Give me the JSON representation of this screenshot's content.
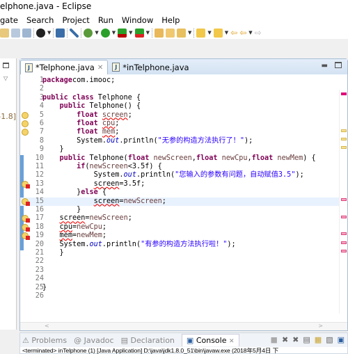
{
  "window": {
    "title": "elphone.java - Eclipse"
  },
  "menu": [
    "gate",
    "Search",
    "Project",
    "Run",
    "Window",
    "Help"
  ],
  "toolbar": {
    "icons": [
      "save-all-icon",
      "print-icon",
      "toggle-mark-icon",
      "person-icon",
      "terminal-icon",
      "skip-breakpoints-icon",
      "debug-icon",
      "run-icon",
      "coverage-icon",
      "external-tools-icon",
      "new-package-icon",
      "open-type-icon",
      "search-icon",
      "next-annotation-icon",
      "prev-annotation-icon",
      "back-icon",
      "forward-icon"
    ]
  },
  "left_panel": {
    "label": "-1.8]"
  },
  "editor": {
    "tabs": [
      {
        "label": "*Telphone.java",
        "active": true
      },
      {
        "label": "*inTelphone.java",
        "active": false
      }
    ],
    "lines": [
      {
        "n": "1",
        "html": [
          [
            "kw",
            "package"
          ],
          [
            "",
            "com.imooc;"
          ]
        ]
      },
      {
        "n": "2",
        "html": []
      },
      {
        "n": "3",
        "html": [
          [
            "kw",
            "public class"
          ],
          [
            "",
            " Telphone {"
          ]
        ]
      },
      {
        "n": "4",
        "html": [
          [
            "",
            "    "
          ],
          [
            "kw",
            "public"
          ],
          [
            "",
            " Telphone() {"
          ]
        ]
      },
      {
        "n": "5",
        "marker": "warning",
        "html": [
          [
            "",
            "        "
          ],
          [
            "kw",
            "float"
          ],
          [
            "",
            " "
          ],
          [
            "var err",
            "screen"
          ],
          [
            "",
            ";"
          ]
        ]
      },
      {
        "n": "6",
        "marker": "warning",
        "html": [
          [
            "",
            "        "
          ],
          [
            "kw",
            "float"
          ],
          [
            "",
            " "
          ],
          [
            "var err",
            "cpu"
          ],
          [
            "",
            ";"
          ]
        ]
      },
      {
        "n": "7",
        "marker": "warning",
        "html": [
          [
            "",
            "        "
          ],
          [
            "kw",
            "float"
          ],
          [
            "",
            " "
          ],
          [
            "var err",
            "mem"
          ],
          [
            "",
            ";"
          ]
        ]
      },
      {
        "n": "8",
        "html": [
          [
            "",
            "        System."
          ],
          [
            "fld",
            "out"
          ],
          [
            "",
            ".println("
          ],
          [
            "str",
            "\"无参的构造方法执行了！\""
          ],
          [
            "",
            ");"
          ]
        ]
      },
      {
        "n": "9",
        "html": [
          [
            "",
            "    }"
          ]
        ]
      },
      {
        "n": "10",
        "html": [
          [
            "",
            "    "
          ],
          [
            "kw",
            "public"
          ],
          [
            "",
            " Telphone("
          ],
          [
            "kw",
            "float"
          ],
          [
            "var",
            " newScreen"
          ],
          [
            "",
            ","
          ],
          [
            "kw",
            "float"
          ],
          [
            "var",
            " newCpu"
          ],
          [
            "",
            ","
          ],
          [
            "kw",
            "float"
          ],
          [
            "var",
            " newMem"
          ],
          [
            "",
            ") {"
          ]
        ]
      },
      {
        "n": "11",
        "html": [
          [
            "",
            "        "
          ],
          [
            "kw",
            "if"
          ],
          [
            "",
            "("
          ],
          [
            "var",
            "newScreen"
          ],
          [
            "",
            "<3.5f) {"
          ]
        ]
      },
      {
        "n": "12",
        "html": [
          [
            "",
            "            System."
          ],
          [
            "fld",
            "out"
          ],
          [
            "",
            ".println("
          ],
          [
            "str",
            "\"您输入的参数有问题，自动赋值3.5\""
          ],
          [
            "",
            ");"
          ]
        ]
      },
      {
        "n": "13",
        "marker": "error",
        "html": [
          [
            "",
            "            "
          ],
          [
            "err",
            "screen"
          ],
          [
            "",
            "=3.5f;"
          ]
        ]
      },
      {
        "n": "14",
        "html": [
          [
            "",
            "        }"
          ],
          [
            "kw",
            "else"
          ],
          [
            "",
            " {"
          ]
        ]
      },
      {
        "n": "15",
        "marker": "error",
        "current": true,
        "html": [
          [
            "",
            "            "
          ],
          [
            "err",
            "screen"
          ],
          [
            "",
            "="
          ],
          [
            "var",
            "newScreen"
          ],
          [
            "",
            ";"
          ]
        ]
      },
      {
        "n": "16",
        "html": [
          [
            "",
            "        }"
          ]
        ]
      },
      {
        "n": "17",
        "marker": "error",
        "html": [
          [
            "",
            "    "
          ],
          [
            "err",
            "screen"
          ],
          [
            "",
            "="
          ],
          [
            "var",
            "newScreen"
          ],
          [
            "",
            ";"
          ]
        ]
      },
      {
        "n": "18",
        "marker": "error",
        "html": [
          [
            "",
            "    "
          ],
          [
            "err",
            "cpu"
          ],
          [
            "",
            "="
          ],
          [
            "var",
            "newCpu"
          ],
          [
            "",
            ";"
          ]
        ]
      },
      {
        "n": "19",
        "marker": "error",
        "html": [
          [
            "",
            "    "
          ],
          [
            "err",
            "mem"
          ],
          [
            "",
            "="
          ],
          [
            "var",
            "newMem"
          ],
          [
            "",
            ";"
          ]
        ]
      },
      {
        "n": "20",
        "html": [
          [
            "",
            "    System."
          ],
          [
            "fld",
            "out"
          ],
          [
            "",
            ".println("
          ],
          [
            "str",
            "\"有参的构造方法执行啦！\""
          ],
          [
            "",
            ");"
          ]
        ]
      },
      {
        "n": "21",
        "html": [
          [
            "",
            "    }"
          ]
        ]
      },
      {
        "n": "22",
        "html": []
      },
      {
        "n": "23",
        "html": []
      },
      {
        "n": "24",
        "html": []
      },
      {
        "n": "25",
        "html": [
          [
            "",
            "}"
          ]
        ]
      },
      {
        "n": "26",
        "html": []
      }
    ]
  },
  "bottom": {
    "tabs": [
      "Problems",
      "Javadoc",
      "Declaration",
      "Console"
    ],
    "active": "Console",
    "console_text": "<terminated> inTelphone (1) [Java Application] D:\\java\\jdk1.8.0_51\\bin\\javaw.exe (2018年5月4日 下"
  },
  "colors": {
    "keyword": "#7f0055",
    "string": "#2a00ff",
    "field": "#0000c0",
    "error": "#e00000",
    "warning": "#f5d36b",
    "current_line": "#e8f2fe"
  }
}
